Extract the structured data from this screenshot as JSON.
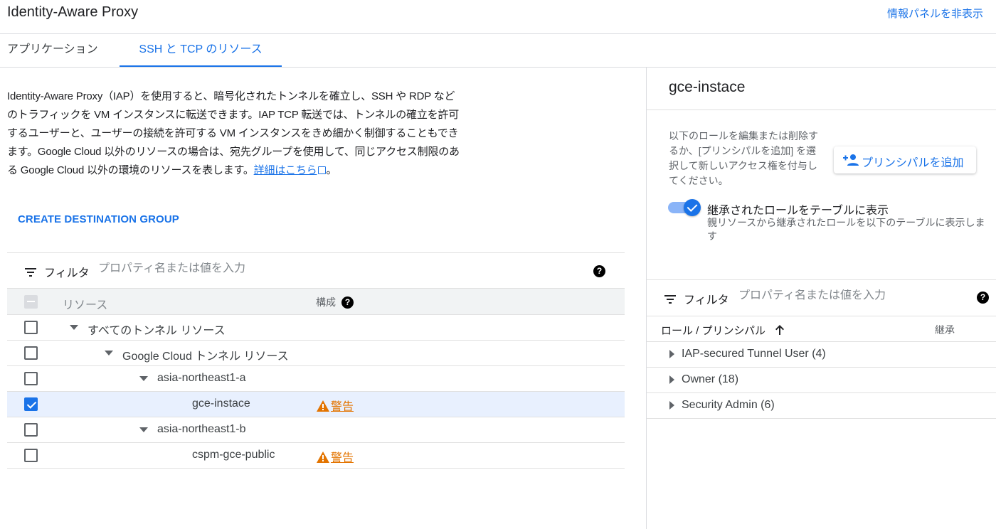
{
  "header": {
    "title": "Identity-Aware Proxy",
    "hide_panel": "情報パネルを非表示"
  },
  "tabs": [
    {
      "label": "アプリケーション",
      "active": false
    },
    {
      "label": "SSH と TCP のリソース",
      "active": true
    }
  ],
  "description": {
    "text": "Identity-Aware Proxy（IAP）を使用すると、暗号化されたトンネルを確立し、SSH や RDP などのトラフィックを VM インスタンスに転送できます。IAP TCP 転送では、トンネルの確立を許可するユーザーと、ユーザーの接続を許可する VM インスタンスをきめ細かく制御することもできます。Google Cloud 以外のリソースの場合は、宛先グループを使用して、同じアクセス制限のある Google Cloud 以外の環境のリソースを表します。",
    "link": "詳細はこちら",
    "end": "。"
  },
  "create_destination_group": "CREATE DESTINATION GROUP",
  "filter": {
    "label": "フィルタ",
    "placeholder": "プロパティ名または値を入力"
  },
  "table": {
    "col_resource": "リソース",
    "col_config": "構成",
    "rows": [
      {
        "label": "すべてのトンネル リソース",
        "checked": false,
        "expandable": true,
        "warning": ""
      },
      {
        "label": "Google Cloud トンネル リソース",
        "checked": false,
        "expandable": true,
        "warning": ""
      },
      {
        "label": "asia-northeast1-a",
        "checked": false,
        "expandable": true,
        "warning": ""
      },
      {
        "label": "gce-instace",
        "checked": true,
        "expandable": false,
        "warning": "警告"
      },
      {
        "label": "asia-northeast1-b",
        "checked": false,
        "expandable": true,
        "warning": ""
      },
      {
        "label": "cspm-gce-public",
        "checked": false,
        "expandable": false,
        "warning": "警告"
      }
    ]
  },
  "info_panel": {
    "title": "gce-instace",
    "description": "以下のロールを編集または削除するか、[プリンシパルを追加] を選択して新しいアクセス権を付与してください。",
    "add_principal": "プリンシパルを追加",
    "inherited_toggle": {
      "label": "継承されたロールをテーブルに表示",
      "help": "親リソースから継承されたロールを以下のテーブルに表示します",
      "on": true
    },
    "filter": {
      "label": "フィルタ",
      "placeholder": "プロパティ名または値を入力"
    },
    "table": {
      "col_role": "ロール / プリンシパル",
      "col_inherited": "継承",
      "rows": [
        {
          "label": "IAP-secured Tunnel User (4)"
        },
        {
          "label": "Owner (18)"
        },
        {
          "label": "Security Admin (6)"
        }
      ]
    }
  },
  "colors": {
    "accent": "#1a73e8",
    "warning": "#e37400",
    "selected_row": "#e8f0fe"
  },
  "icons": [
    "filter-icon",
    "help-icon",
    "external-link-icon",
    "warning-icon",
    "add-person-icon",
    "caret-down-icon",
    "caret-right-icon",
    "sort-arrow-up-icon",
    "checkmark-icon"
  ]
}
